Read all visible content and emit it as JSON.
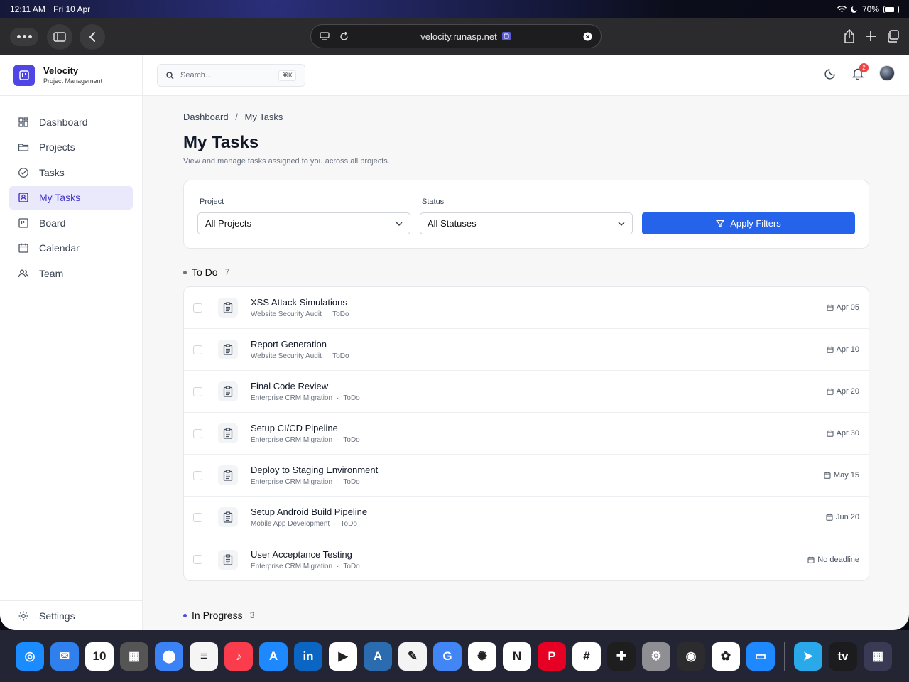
{
  "status_bar": {
    "time": "12:11 AM",
    "date": "Fri 10 Apr",
    "battery": "70%",
    "battery_level": 0.7
  },
  "browser": {
    "url": "velocity.runasp.net"
  },
  "brand": {
    "title": "Velocity",
    "subtitle": "Project Management"
  },
  "sidebar": {
    "items": [
      {
        "label": "Dashboard",
        "icon": "dashboard-icon"
      },
      {
        "label": "Projects",
        "icon": "folder-icon"
      },
      {
        "label": "Tasks",
        "icon": "check-circle-icon"
      },
      {
        "label": "My Tasks",
        "icon": "user-badge-icon",
        "active": true
      },
      {
        "label": "Board",
        "icon": "board-icon"
      },
      {
        "label": "Calendar",
        "icon": "calendar-icon"
      },
      {
        "label": "Team",
        "icon": "team-icon"
      }
    ],
    "settings_label": "Settings"
  },
  "topbar": {
    "search_placeholder": "Search...",
    "search_shortcut": "⌘K",
    "notification_count": "2"
  },
  "breadcrumb": {
    "root": "Dashboard",
    "separator": "/",
    "current": "My Tasks"
  },
  "page": {
    "title": "My Tasks",
    "description": "View and manage tasks assigned to you across all projects."
  },
  "filters": {
    "project_label": "Project",
    "project_value": "All Projects",
    "status_label": "Status",
    "status_value": "All Statuses",
    "apply_label": "Apply Filters"
  },
  "sections": {
    "todo": {
      "title": "To Do",
      "count": "7"
    },
    "in_progress": {
      "title": "In Progress",
      "count": "3"
    }
  },
  "tasks": [
    {
      "name": "XSS Attack Simulations",
      "project": "Website Security Audit",
      "status": "ToDo",
      "due": "Apr 05"
    },
    {
      "name": "Report Generation",
      "project": "Website Security Audit",
      "status": "ToDo",
      "due": "Apr 10"
    },
    {
      "name": "Final Code Review",
      "project": "Enterprise CRM Migration",
      "status": "ToDo",
      "due": "Apr 20"
    },
    {
      "name": "Setup CI/CD Pipeline",
      "project": "Enterprise CRM Migration",
      "status": "ToDo",
      "due": "Apr 30"
    },
    {
      "name": "Deploy to Staging Environment",
      "project": "Enterprise CRM Migration",
      "status": "ToDo",
      "due": "May 15"
    },
    {
      "name": "Setup Android Build Pipeline",
      "project": "Mobile App Development",
      "status": "ToDo",
      "due": "Jun 20"
    },
    {
      "name": "User Acceptance Testing",
      "project": "Enterprise CRM Migration",
      "status": "ToDo",
      "due": "No deadline"
    }
  ],
  "dock": {
    "apps": [
      {
        "name": "safari",
        "color": "#1a8cff",
        "glyph": "◎"
      },
      {
        "name": "mail",
        "color": "#2f80ed",
        "glyph": "✉"
      },
      {
        "name": "calendar",
        "color": "#ffffff",
        "glyph": "10"
      },
      {
        "name": "calculator",
        "color": "#555555",
        "glyph": "▦"
      },
      {
        "name": "database",
        "color": "#3b82f6",
        "glyph": "⬤"
      },
      {
        "name": "notes",
        "color": "#f5f5f5",
        "glyph": "≡"
      },
      {
        "name": "music",
        "color": "#fa3c4c",
        "glyph": "♪"
      },
      {
        "name": "app-store",
        "color": "#1e88ff",
        "glyph": "A"
      },
      {
        "name": "linkedin",
        "color": "#0a66c2",
        "glyph": "in"
      },
      {
        "name": "youtube",
        "color": "#ffffff",
        "glyph": "▶"
      },
      {
        "name": "translate",
        "color": "#2b6cb0",
        "glyph": "A"
      },
      {
        "name": "freeform",
        "color": "#f4f4f4",
        "glyph": "✎"
      },
      {
        "name": "google-translate",
        "color": "#4285f4",
        "glyph": "G"
      },
      {
        "name": "chatgpt",
        "color": "#ffffff",
        "glyph": "✺"
      },
      {
        "name": "notion",
        "color": "#ffffff",
        "glyph": "N"
      },
      {
        "name": "pinterest",
        "color": "#e60023",
        "glyph": "P"
      },
      {
        "name": "slack",
        "color": "#ffffff",
        "glyph": "#"
      },
      {
        "name": "figma",
        "color": "#1e1e1e",
        "glyph": "✚"
      },
      {
        "name": "settings",
        "color": "#8e8e93",
        "glyph": "⚙"
      },
      {
        "name": "camera",
        "color": "#2c2c2e",
        "glyph": "◉"
      },
      {
        "name": "photos",
        "color": "#ffffff",
        "glyph": "✿"
      },
      {
        "name": "files",
        "color": "#1e88ff",
        "glyph": "▭"
      },
      {
        "name": "telegram",
        "color": "#29a9ea",
        "glyph": "➤"
      },
      {
        "name": "apple-tv",
        "color": "#1c1c1e",
        "glyph": "tv"
      },
      {
        "name": "app-library",
        "color": "#3a3a55",
        "glyph": "▦"
      }
    ]
  }
}
